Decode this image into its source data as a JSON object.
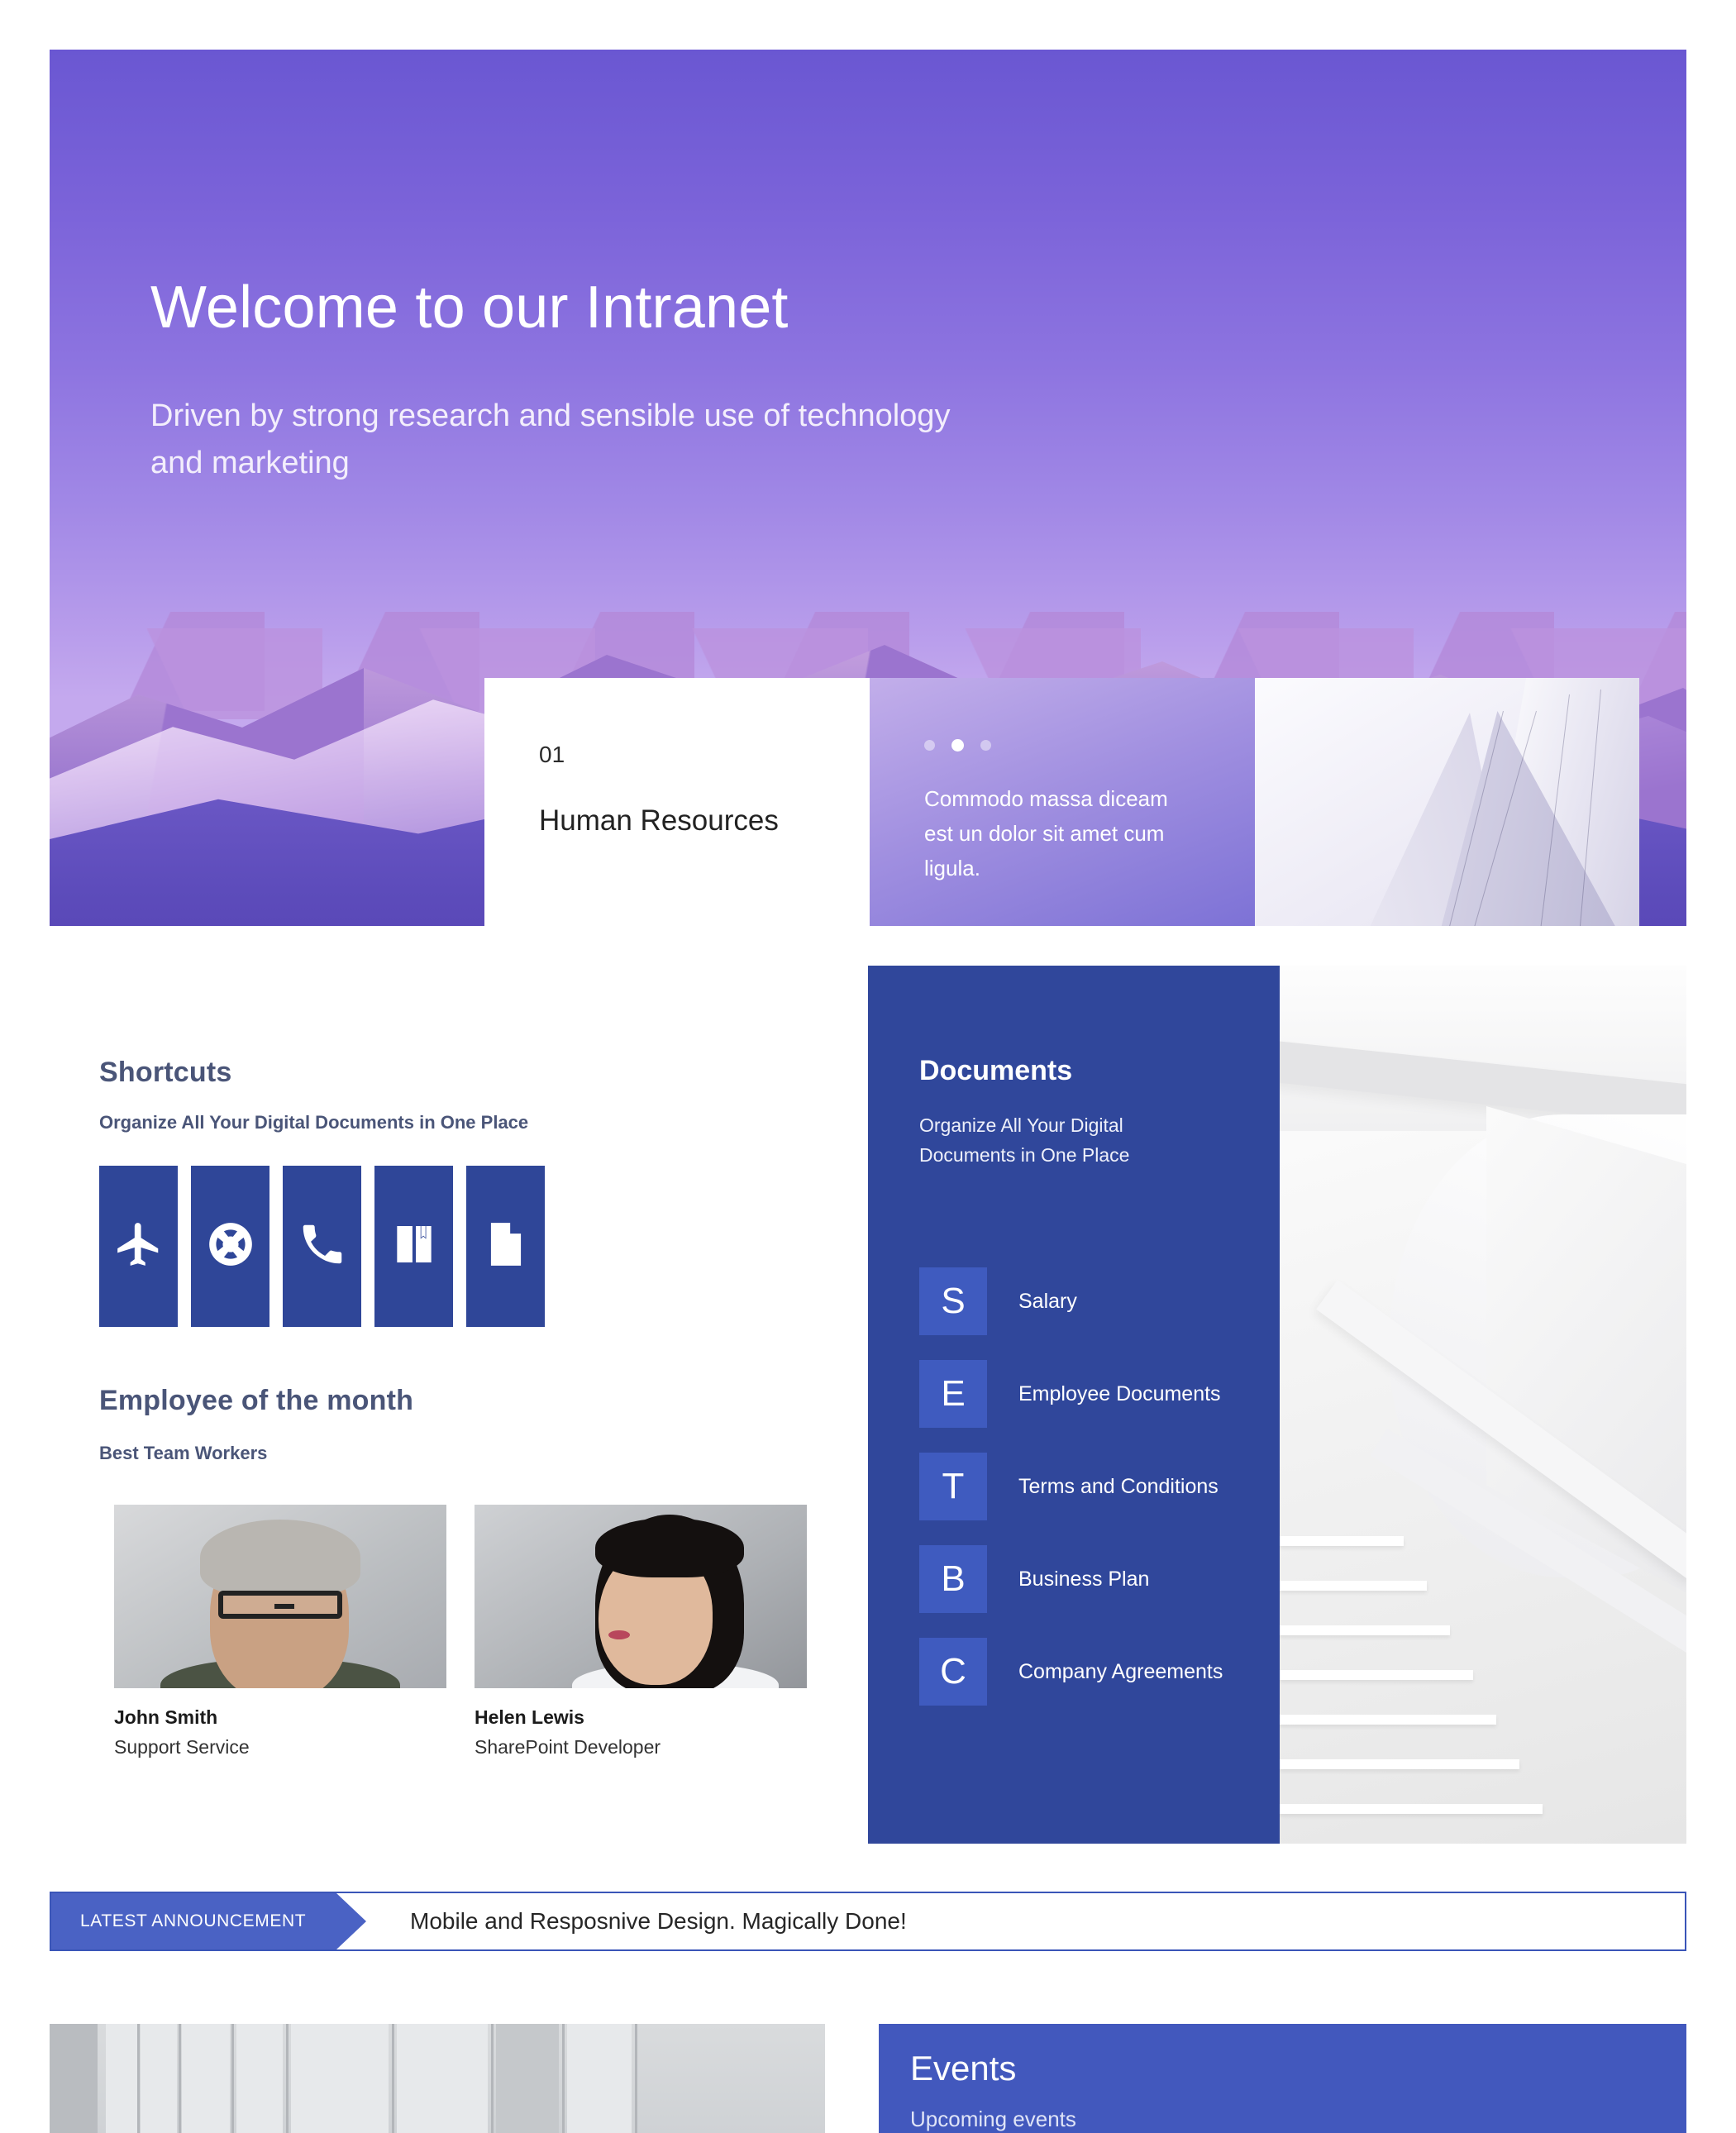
{
  "hero": {
    "title": "Welcome to our Intranet",
    "subtitle": "Driven by strong research and sensible use of technology and marketing",
    "background_image": "purple-tinted-mountain-range-photo",
    "gradient_top": "#6a57d2",
    "gradient_bottom": "#c4a9ee"
  },
  "hero_cards": {
    "featured": {
      "number": "01",
      "title": "Human Resources",
      "background": "#ffffff"
    },
    "quote": {
      "text": "Commodo massa diceam est un dolor sit amet cum ligula.",
      "dots_total": 3,
      "active_dot_index": 1,
      "background": "#a08fe0"
    },
    "image_card": {
      "image": "modern-architecture-spire-photo"
    }
  },
  "shortcuts": {
    "title": "Shortcuts",
    "subtitle": "Organize All Your Digital Documents in One Place",
    "tile_color": "#2f4698",
    "items": [
      {
        "icon": "airplane-icon",
        "label": "Travel"
      },
      {
        "icon": "life-preserver-icon",
        "label": "Support"
      },
      {
        "icon": "phone-icon",
        "label": "Contact"
      },
      {
        "icon": "book-bookmark-icon",
        "label": "Handbook"
      },
      {
        "icon": "document-icon",
        "label": "Documents"
      }
    ]
  },
  "employee_of_the_month": {
    "title": "Employee of the month",
    "subtitle": "Best Team Workers",
    "people": [
      {
        "name": "John Smith",
        "role": "Support Service",
        "photo": "portrait-man-glasses"
      },
      {
        "name": "Helen Lewis",
        "role": "SharePoint Developer",
        "photo": "portrait-woman-dark-hair"
      }
    ]
  },
  "documents": {
    "title": "Documents",
    "subtitle": "Organize All Your Digital Documents in One Place",
    "panel_color": "#30479b",
    "letter_tile_color": "#3f5bbf",
    "items": [
      {
        "letter": "S",
        "label": "Salary"
      },
      {
        "letter": "E",
        "label": "Employee Documents"
      },
      {
        "letter": "T",
        "label": "Terms and Conditions"
      },
      {
        "letter": "B",
        "label": "Business Plan"
      },
      {
        "letter": "C",
        "label": "Company Agreements"
      }
    ],
    "side_image": "white-minimal-staircase-photo"
  },
  "announcement": {
    "tag": "LATEST ANNOUNCEMENT",
    "text": "Mobile and Resposnive Design. Magically Done!",
    "accent_color": "#4a62c4"
  },
  "bottom": {
    "left_image": "grey-building-facade-slats-photo",
    "events": {
      "title": "Events",
      "subtitle": "Upcoming events",
      "background": "#4258bd"
    }
  }
}
